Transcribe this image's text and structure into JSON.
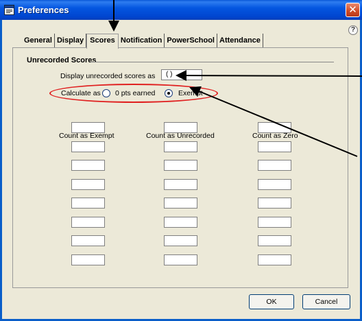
{
  "window": {
    "title": "Preferences",
    "close_glyph": "✕",
    "help_glyph": "?"
  },
  "tabs": [
    {
      "label": "General",
      "active": false
    },
    {
      "label": "Display",
      "active": false
    },
    {
      "label": "Scores",
      "active": true
    },
    {
      "label": "Notification",
      "active": false
    },
    {
      "label": "PowerSchool",
      "active": false
    },
    {
      "label": "Attendance",
      "active": false
    }
  ],
  "unrecorded": {
    "group_title": "Unrecorded Scores",
    "display_label": "Display unrecorded scores as",
    "display_value": "( )",
    "calculate_label": "Calculate as",
    "options": [
      {
        "label": "0 pts earned",
        "selected": false
      },
      {
        "label": "Exempt",
        "selected": true
      }
    ]
  },
  "columns": [
    {
      "header": "Count as Exempt",
      "values": [
        "",
        "",
        "",
        "",
        "",
        "",
        "",
        ""
      ]
    },
    {
      "header": "Count as Unrecorded",
      "values": [
        "",
        "",
        "",
        "",
        "",
        "",
        "",
        ""
      ]
    },
    {
      "header": "Count as Zero",
      "values": [
        "",
        "",
        "",
        "",
        "",
        "",
        "",
        ""
      ]
    }
  ],
  "buttons": {
    "ok": "OK",
    "cancel": "Cancel"
  },
  "colors": {
    "titlebar": "#0a5ec9",
    "annotation_ellipse": "#e02020",
    "dialog_bg": "#ece9d8"
  },
  "icons": [
    "window-icon",
    "close-icon",
    "help-icon"
  ]
}
